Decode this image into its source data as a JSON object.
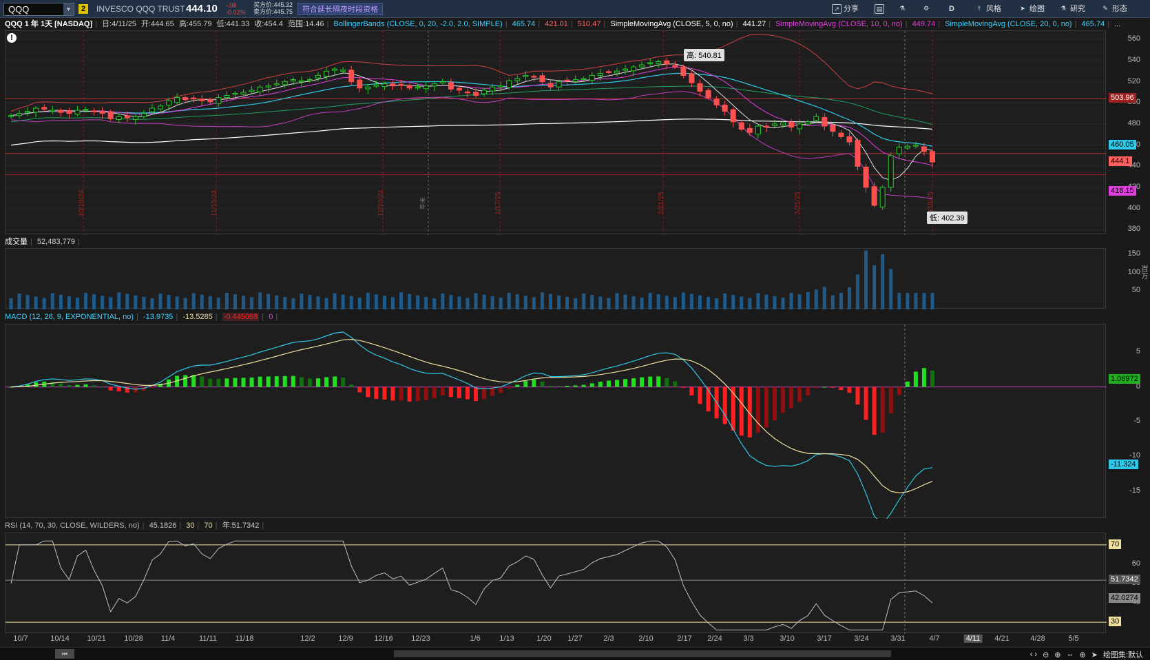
{
  "toolbar": {
    "symbol": "QQQ",
    "link_badge": "2",
    "company": "INVESCO QQQ TRUST",
    "last": "444.10",
    "change": "-.08",
    "change_pct": "-0.02%",
    "bid": "买方价:445.32",
    "ask": "卖方价:445.75",
    "ext_hours": "符合延长隔夜时段资格",
    "share": "分享",
    "period": "D",
    "style": "风格",
    "draw": "绘图",
    "research": "研究",
    "patterns": "形态"
  },
  "price_header": {
    "title": "QQQ 1 年 1天 [NASDAQ]",
    "date": "日:4/11/25",
    "open": "开:444.65",
    "high": "高:455.79",
    "low": "低:441.33",
    "close": "收:454.4",
    "range": "范围:14.46",
    "bb_label": "BollingerBands (CLOSE, 0, 20, -2.0, 2.0, SIMPLE)",
    "bb_mid": "465.74",
    "bb_low": "421.01",
    "bb_up": "510.47",
    "sma5_label": "SimpleMovingAvg (CLOSE, 5, 0, no)",
    "sma5": "441.27",
    "sma10_label": "SimpleMovingAvg (CLOSE, 10, 0, no)",
    "sma10": "449.74",
    "sma20_label": "SimpleMovingAvg (CLOSE, 20, 0, no)",
    "sma20": "465.74",
    "more": "..."
  },
  "price_axis": {
    "ticks": [
      "560",
      "540",
      "520",
      "500",
      "480",
      "460",
      "440",
      "420",
      "400",
      "380"
    ],
    "tag_upper": "503.96",
    "tag_mid": "460.05",
    "tag_last": "444.1",
    "tag_lower": "416.15"
  },
  "price_annotations": {
    "high": "高: 540.81",
    "low": "低: 402.39",
    "year_end": "年末"
  },
  "vertical_dates": [
    "10/18/24",
    "11/15/24",
    "12/20/24",
    "1/17/25",
    "2/21/25",
    "3/21/25",
    "4/18/25"
  ],
  "volume": {
    "label": "成交量",
    "value": "52,483,779",
    "ticks": [
      "150",
      "100",
      "50"
    ],
    "unit": "百万"
  },
  "macd": {
    "label": "MACD (12, 26, 9, EXPONENTIAL, no)",
    "value": "-13.9735",
    "avg": "-13.5285",
    "diff": "-0.445068",
    "zero": "0",
    "ticks": [
      "5",
      "0",
      "-5",
      "-10",
      "-15"
    ],
    "tag_hist": "1.06972",
    "tag_value": "-11.324"
  },
  "rsi": {
    "label": "RSI (14, 70, 30, CLOSE, WILDERS, no)",
    "value": "45.1826",
    "os": "30",
    "ob": "70",
    "year": "年:51.7342",
    "ticks": [
      "70",
      "60",
      "50",
      "40",
      "30"
    ],
    "tag_year": "51.7342",
    "tag_value": "42.0274"
  },
  "dates": [
    "10/7",
    "10/14",
    "10/21",
    "10/28",
    "11/4",
    "11/11",
    "11/18",
    "12/2",
    "12/9",
    "12/16",
    "12/23",
    "1/6",
    "1/13",
    "1/20",
    "1/27",
    "2/3",
    "2/10",
    "2/17",
    "2/24",
    "3/3",
    "3/10",
    "3/17",
    "3/24",
    "3/31",
    "4/7",
    "4/11",
    "4/21",
    "4/28",
    "5/5"
  ],
  "statusbar": {
    "zoom_label": "绘图集:默认"
  },
  "chart_data": {
    "type": "candlestick",
    "title": "QQQ 1 年 1天 [NASDAQ]",
    "ylim": [
      375,
      568
    ],
    "closes": [
      488,
      490,
      492,
      495,
      494,
      493,
      491,
      490,
      493,
      494,
      492,
      490,
      485,
      487,
      486,
      487,
      490,
      495,
      497,
      502,
      505,
      503,
      504,
      502,
      501,
      505,
      507,
      509,
      510,
      512,
      515,
      516,
      518,
      520,
      522,
      521,
      522,
      526,
      530,
      532,
      531,
      520,
      514,
      515,
      517,
      518,
      516,
      517,
      514,
      515,
      516,
      518,
      520,
      513,
      512,
      510,
      507,
      512,
      515,
      516,
      521,
      523,
      526,
      525,
      520,
      515,
      520,
      521,
      522,
      523,
      526,
      528,
      529,
      530,
      532,
      534,
      536,
      538,
      539,
      537,
      534,
      526,
      519,
      511,
      505,
      498,
      492,
      482,
      475,
      472,
      478,
      477,
      480,
      481,
      477,
      480,
      482,
      487,
      478,
      473,
      468,
      463,
      440,
      420,
      403,
      420,
      450,
      458,
      459,
      460,
      454,
      444
    ]
  }
}
